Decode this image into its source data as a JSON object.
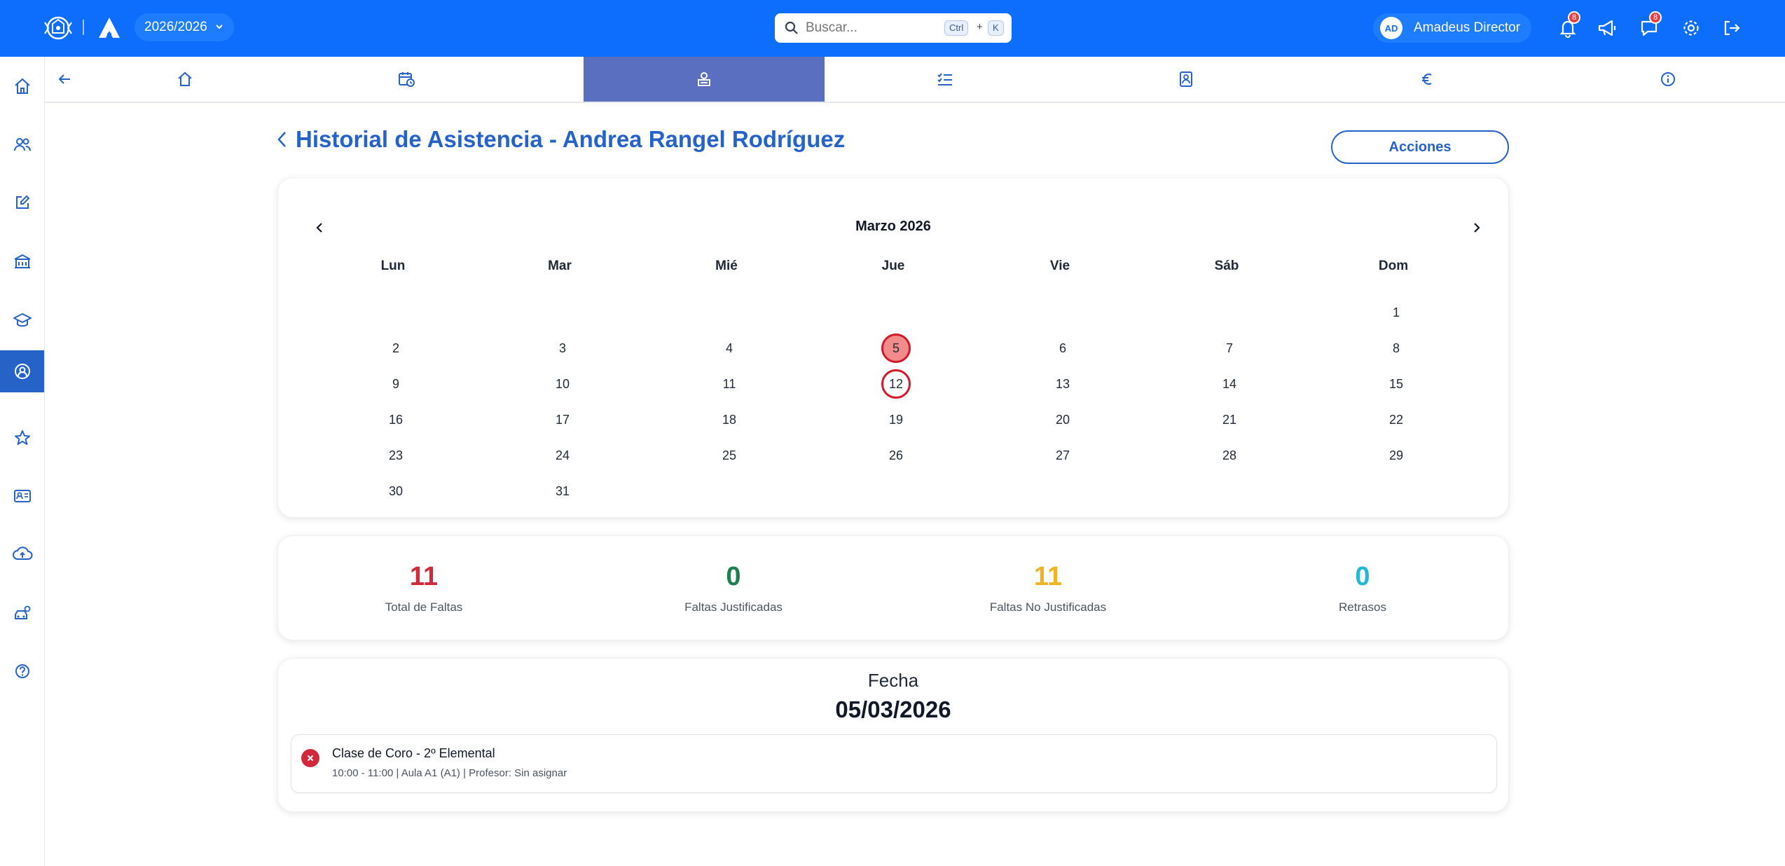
{
  "header": {
    "academic_year": "2026/2026",
    "search_placeholder": "Buscar...",
    "shortcut_ctrl": "Ctrl",
    "shortcut_plus": "+",
    "shortcut_key": "K",
    "user_initials": "AD",
    "user_name": "Amadeus Director",
    "notifications_count": "8",
    "messages_count": "8",
    "brand_color": "#0d6efd"
  },
  "sidebar": {
    "items": [
      "home-icon",
      "users-icon",
      "edit-icon",
      "building-icon",
      "graduation-icon",
      "user-circle-icon",
      "star-icon",
      "id-card-icon",
      "cloud-upload-icon",
      "settings-car-icon",
      "help-icon"
    ],
    "active_index": 5
  },
  "tabs": {
    "items": [
      "back-arrow-icon",
      "home-icon",
      "calendar-clock-icon",
      "attendance-icon",
      "checklist-icon",
      "profile-book-icon",
      "euro-icon",
      "info-icon"
    ],
    "active_index": 3
  },
  "page": {
    "title": "Historial de Asistencia - Andrea Rangel Rodríguez",
    "actions_label": "Acciones"
  },
  "calendar": {
    "month_label": "Marzo 2026",
    "weekdays": [
      "Lun",
      "Mar",
      "Mié",
      "Jue",
      "Vie",
      "Sáb",
      "Dom"
    ],
    "first_weekday_index": 6,
    "days_in_month": 31,
    "selected_day": 5,
    "absence_days": [
      5,
      12
    ],
    "absence_color": "#d11a2a"
  },
  "stats": [
    {
      "value": "11",
      "label": "Total de Faltas",
      "color": "#d1283a"
    },
    {
      "value": "0",
      "label": "Faltas Justificadas",
      "color": "#1e7e4f"
    },
    {
      "value": "11",
      "label": "Faltas No Justificadas",
      "color": "#f0b323"
    },
    {
      "value": "0",
      "label": "Retrasos",
      "color": "#22b8d6"
    }
  ],
  "detail": {
    "fecha_label": "Fecha",
    "fecha_value": "05/03/2026",
    "sessions": [
      {
        "title": "Clase de Coro - 2º Elemental",
        "meta": "10:00 - 11:00 | Aula A1 (A1) | Profesor: Sin asignar",
        "status": "absent"
      }
    ]
  }
}
